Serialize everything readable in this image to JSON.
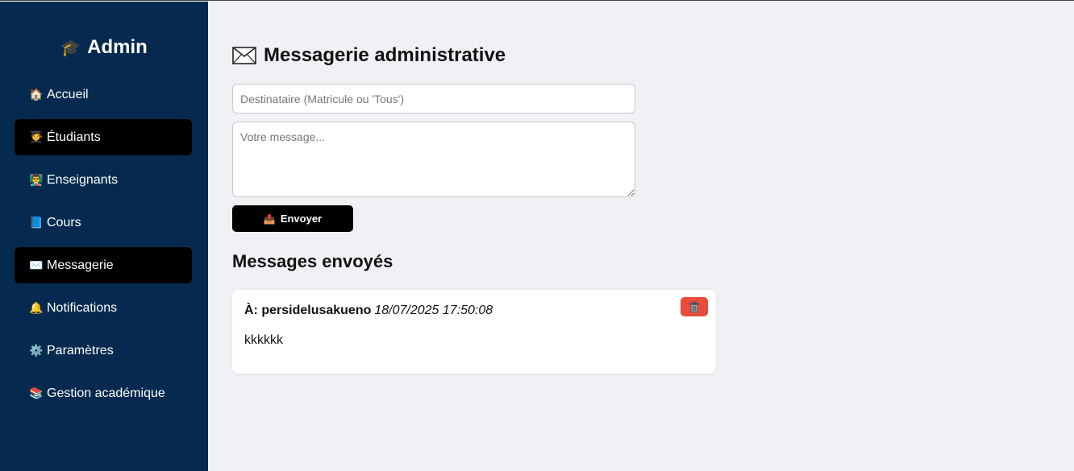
{
  "sidebar": {
    "brand": {
      "icon": "graduation-cap-icon",
      "glyph": "🎓",
      "title": "Admin"
    },
    "items": [
      {
        "glyph": "🏠",
        "label": "Accueil",
        "active": false
      },
      {
        "glyph": "🧑‍🎓",
        "label": "Étudiants",
        "active": true
      },
      {
        "glyph": "👨‍🏫",
        "label": "Enseignants",
        "active": false
      },
      {
        "glyph": "📘",
        "label": "Cours",
        "active": false
      },
      {
        "glyph": "✉️",
        "label": "Messagerie",
        "active": true
      },
      {
        "glyph": "🔔",
        "label": "Notifications",
        "active": false
      },
      {
        "glyph": "⚙️",
        "label": "Paramètres",
        "active": false
      },
      {
        "glyph": "📚",
        "label": "Gestion académique",
        "active": false
      }
    ]
  },
  "main": {
    "title": "Messagerie administrative",
    "title_icon": "envelope-icon",
    "recipient_placeholder": "Destinataire (Matricule ou 'Tous')",
    "recipient_value": "",
    "message_placeholder": "Votre message...",
    "message_value": "",
    "send_glyph": "📤",
    "send_label": "Envoyer",
    "sent_title": "Messages envoyés",
    "messages": [
      {
        "to_label": "À: persidelusakueno",
        "date": "18/07/2025 17:50:08",
        "body": "kkkkkk",
        "delete_icon": "trash-icon"
      }
    ]
  },
  "colors": {
    "sidebar_bg": "#062a4f",
    "active_item_bg": "#000000",
    "page_bg": "#f0f1f5",
    "delete_button": "#e74c3c"
  }
}
